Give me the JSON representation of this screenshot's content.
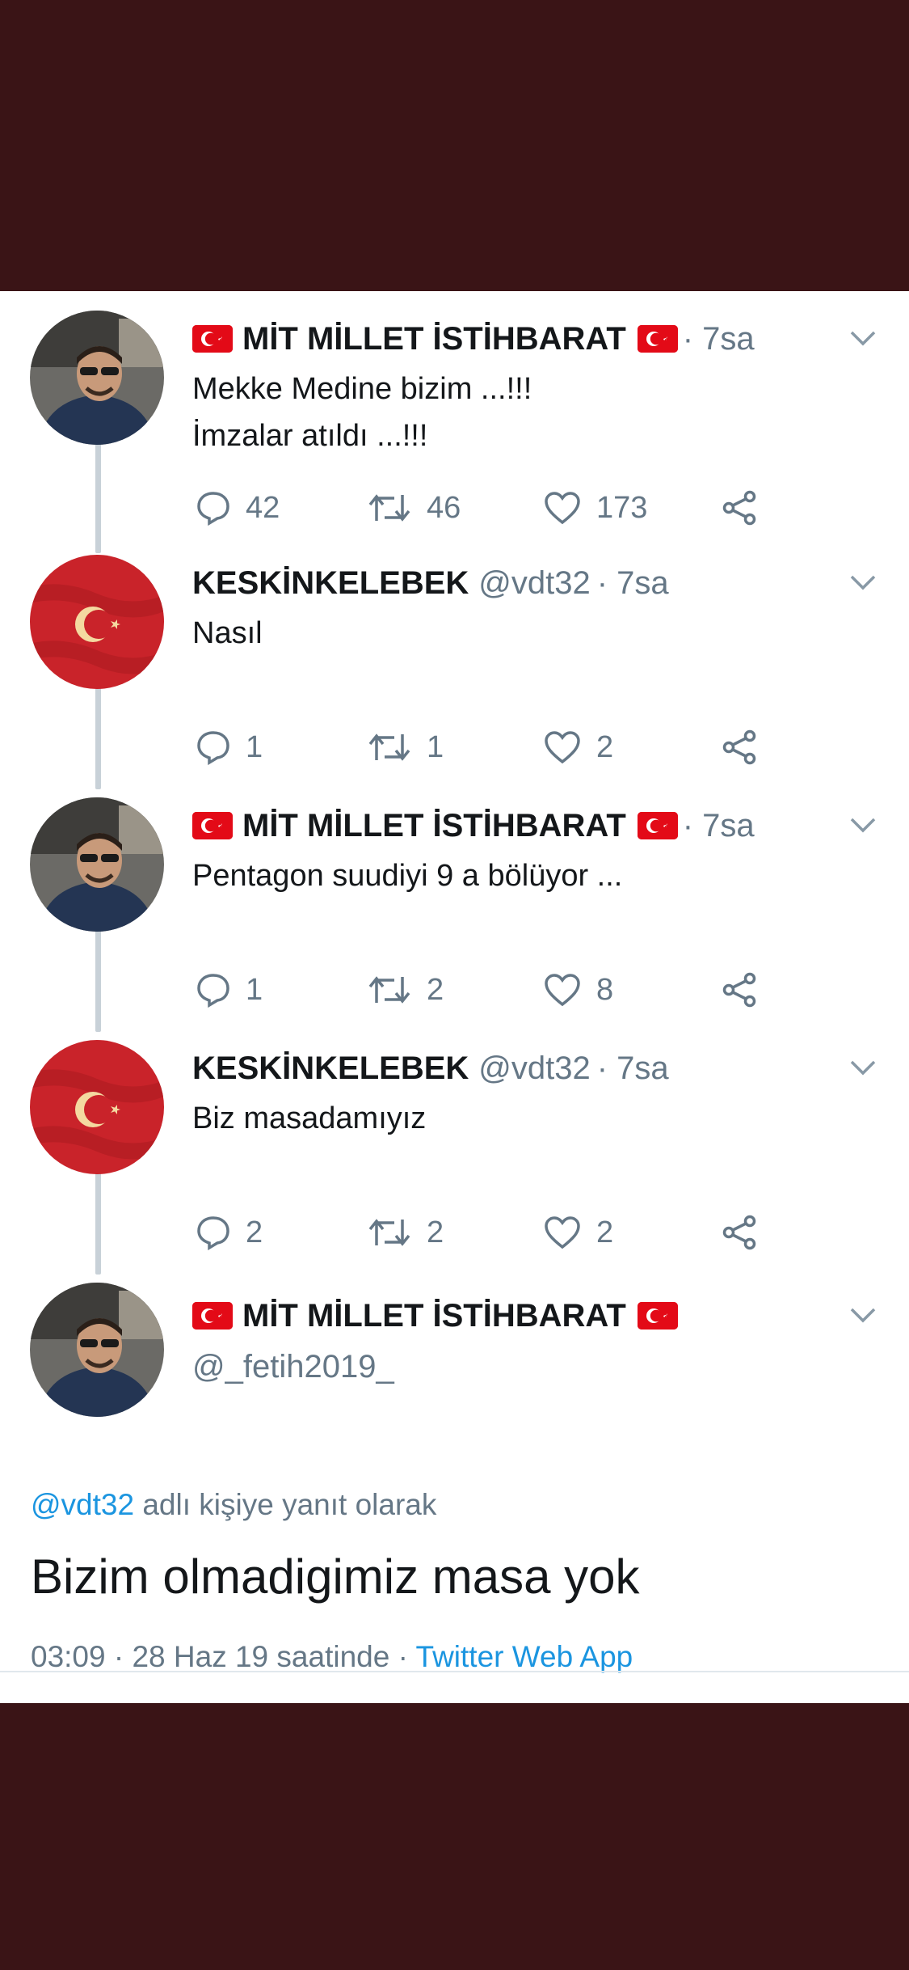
{
  "tweets": [
    {
      "name": "MİT MİLLET İSTİHBARAT",
      "handle": "",
      "time": "· 7sa",
      "text": "Mekke Medine bizim ...!!!\nİmzalar atıldı ...!!!",
      "replies": "42",
      "retweets": "46",
      "likes": "173",
      "avatar": "man-sunglasses-car"
    },
    {
      "name": "KESKİNKELEBEK",
      "handle": "@vdt32",
      "time": "· 7sa",
      "text": "Nasıl",
      "replies": "1",
      "retweets": "1",
      "likes": "2",
      "avatar": "turkish-flag-red"
    },
    {
      "name": "MİT MİLLET İSTİHBARAT",
      "handle": "",
      "time": "· 7sa",
      "text": "Pentagon suudiyi 9 a bölüyor ...",
      "replies": "1",
      "retweets": "2",
      "likes": "8",
      "avatar": "man-sunglasses-car"
    },
    {
      "name": "KESKİNKELEBEK",
      "handle": "@vdt32",
      "time": "· 7sa",
      "text": "Biz masadamıyız",
      "replies": "2",
      "retweets": "2",
      "likes": "2",
      "avatar": "turkish-flag-red"
    }
  ],
  "focused": {
    "name": "MİT MİLLET İSTİHBARAT",
    "handle": "@_fetih2019_",
    "replying_mention": "@vdt32",
    "replying_suffix": " adlı kişiye yanıt olarak",
    "text": "Bizim olmadigimiz masa yok",
    "timestamp": "03:09 · 28 Haz 19 saatinde · ",
    "app": "Twitter Web App"
  },
  "colors": {
    "background": "#3a1416",
    "card": "#ffffff",
    "secondary_text": "#657786",
    "link": "#1b95e0",
    "flag_red": "#e30a17",
    "thread_line": "#c8d1d8"
  }
}
